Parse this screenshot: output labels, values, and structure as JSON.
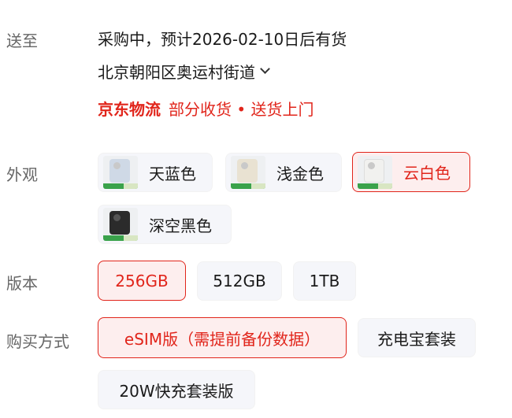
{
  "shipping": {
    "label": "送至",
    "status": "采购中，预计2026-02-10日后有货",
    "address": "北京朝阳区奥运村街道",
    "logistics_brand": "京东物流",
    "logistics_note": "部分收货 • 送货上门"
  },
  "appearance": {
    "label": "外观",
    "options": [
      {
        "label": "天蓝色",
        "color": "#cfd9e6",
        "selected": false
      },
      {
        "label": "浅金色",
        "color": "#e9e2d2",
        "selected": false
      },
      {
        "label": "云白色",
        "color": "#f1f1ef",
        "selected": true
      },
      {
        "label": "深空黑色",
        "color": "#2b2b2b",
        "selected": false
      }
    ]
  },
  "version": {
    "label": "版本",
    "options": [
      {
        "label": "256GB",
        "selected": true
      },
      {
        "label": "512GB",
        "selected": false
      },
      {
        "label": "1TB",
        "selected": false
      }
    ]
  },
  "purchase": {
    "label": "购买方式",
    "options": [
      {
        "label": "eSIM版（需提前备份数据）",
        "selected": true
      },
      {
        "label": "充电宝套装",
        "selected": false
      },
      {
        "label": "20W快充套装版",
        "selected": false
      }
    ]
  },
  "colors": {
    "accent": "#e1251b",
    "selected_bg": "#fdeeee",
    "chip_bg": "#f5f6fa",
    "label_gray": "#666666"
  }
}
